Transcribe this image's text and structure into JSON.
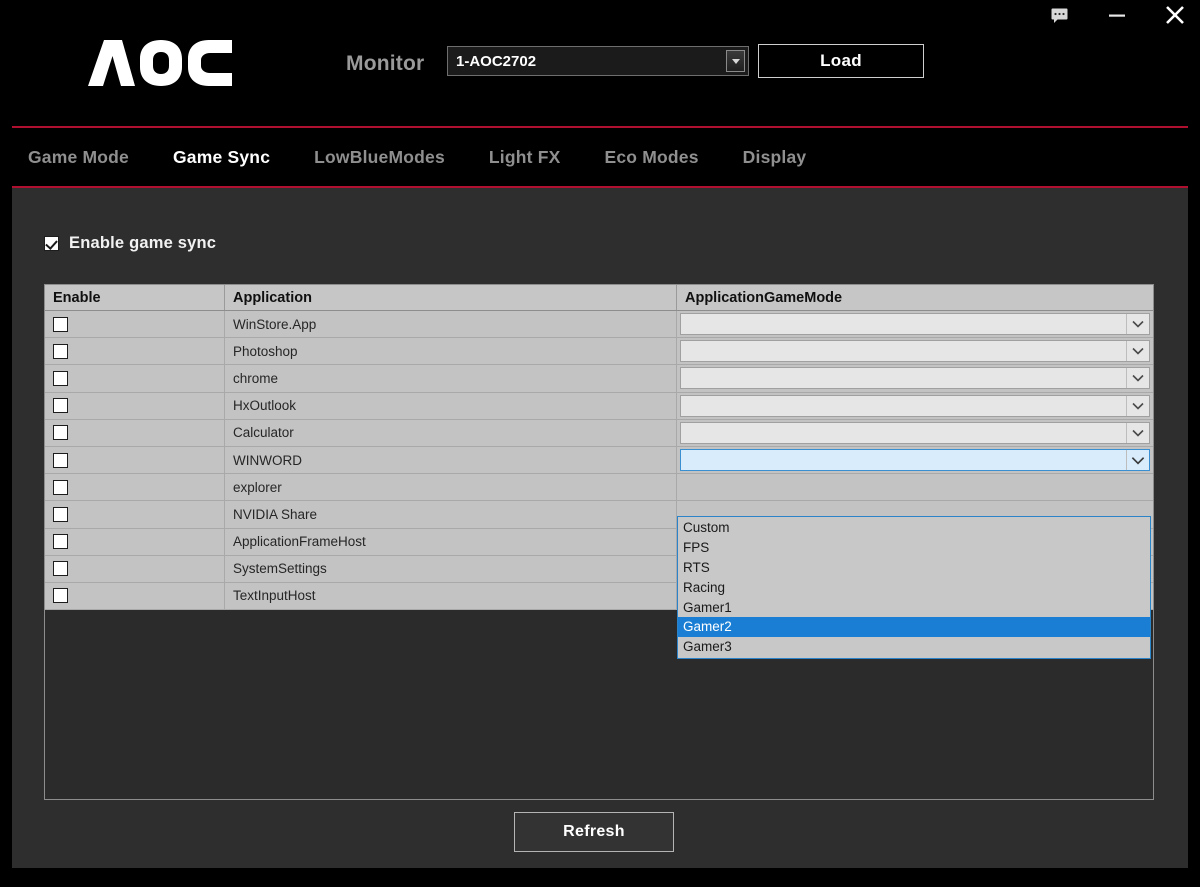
{
  "titlebar": {
    "feedback_icon": "speech-bubble-icon",
    "minimize_icon": "minimize-icon",
    "close_icon": "close-icon"
  },
  "header": {
    "logo_text": "AOC",
    "monitor_label": "Monitor",
    "monitor_value": "1-AOC2702",
    "load_label": "Load"
  },
  "tabs": [
    {
      "label": "Game Mode",
      "active": false
    },
    {
      "label": "Game Sync",
      "active": true
    },
    {
      "label": "LowBlueModes",
      "active": false
    },
    {
      "label": "Light FX",
      "active": false
    },
    {
      "label": "Eco Modes",
      "active": false
    },
    {
      "label": "Display",
      "active": false
    }
  ],
  "content": {
    "enable_sync_label": "Enable game sync",
    "enable_sync_checked": true,
    "columns": [
      "Enable",
      "Application",
      "ApplicationGameMode"
    ],
    "rows": [
      {
        "enabled": false,
        "application": "WinStore.App",
        "mode": ""
      },
      {
        "enabled": false,
        "application": "Photoshop",
        "mode": ""
      },
      {
        "enabled": false,
        "application": "chrome",
        "mode": ""
      },
      {
        "enabled": false,
        "application": "HxOutlook",
        "mode": ""
      },
      {
        "enabled": false,
        "application": "Calculator",
        "mode": ""
      },
      {
        "enabled": false,
        "application": "WINWORD",
        "mode": ""
      },
      {
        "enabled": false,
        "application": "explorer",
        "mode": ""
      },
      {
        "enabled": false,
        "application": "NVIDIA Share",
        "mode": ""
      },
      {
        "enabled": false,
        "application": "ApplicationFrameHost",
        "mode": ""
      },
      {
        "enabled": false,
        "application": "SystemSettings",
        "mode": ""
      },
      {
        "enabled": false,
        "application": "TextInputHost",
        "mode": ""
      }
    ],
    "open_dropdown": {
      "row_index": 5,
      "options": [
        "Custom",
        "FPS",
        "RTS",
        "Racing",
        "Gamer1",
        "Gamer2",
        "Gamer3"
      ],
      "selected": "Gamer2"
    },
    "refresh_label": "Refresh"
  },
  "colors": {
    "window_background": "#000000",
    "panel_background": "#2e2e2e",
    "accent_red": "#b01030",
    "grid_header": "#c6c6c6",
    "grid_row": "#c3c3c3",
    "selection_blue": "#1a7fd4",
    "focus_blue": "#3a8fd0"
  }
}
